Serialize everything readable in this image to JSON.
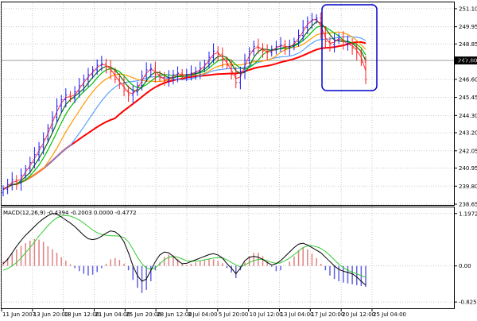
{
  "chart_data": {
    "type": "line",
    "price_panel": {
      "y_ticks": [
        "251.10",
        "249.95",
        "248.85",
        "247.80",
        "246.60",
        "245.45",
        "244.30",
        "243.20",
        "242.05",
        "240.95",
        "239.80",
        "238.65"
      ],
      "y_tick_values": [
        251.1,
        249.95,
        248.85,
        247.8,
        246.6,
        245.45,
        244.3,
        243.2,
        242.05,
        240.95,
        239.8,
        238.65
      ],
      "ylim": [
        238.65,
        251.45
      ],
      "current_price": "247.80",
      "current_price_value": 247.8,
      "grid": true,
      "series_colors": {
        "bars": "#1a1aff",
        "bars_down": "#ff2020",
        "ma1": "#ff3030",
        "ma2": "#007000",
        "ma3": "#00c000",
        "ma4": "#ff9900",
        "ma5": "#5aa0ff",
        "ma6": "#ff0000"
      },
      "close": [
        239.6,
        239.9,
        240.2,
        240.0,
        240.5,
        240.9,
        241.3,
        241.8,
        242.3,
        242.8,
        243.5,
        244.2,
        244.9,
        245.3,
        245.6,
        245.4,
        245.8,
        246.2,
        246.6,
        246.9,
        247.2,
        247.5,
        247.6,
        247.4,
        247.1,
        246.6,
        246.3,
        245.9,
        245.6,
        245.8,
        246.2,
        246.8,
        247.2,
        247.3,
        246.9,
        246.7,
        246.5,
        246.7,
        246.9,
        247.0,
        246.8,
        246.9,
        247.0,
        247.1,
        247.3,
        247.6,
        248.0,
        248.4,
        248.2,
        247.8,
        247.5,
        246.9,
        246.4,
        247.1,
        247.8,
        248.4,
        248.7,
        248.6,
        248.4,
        248.3,
        248.5,
        248.7,
        248.8,
        248.6,
        248.7,
        249.0,
        249.4,
        249.9,
        250.3,
        250.4,
        250.5,
        249.5,
        249.0,
        248.8,
        249.1,
        249.3,
        248.8,
        248.9,
        248.6,
        248.3,
        247.7,
        246.6
      ]
    },
    "macd_panel": {
      "label": "MACD(12,26,9) -0.4394 -0.2003 0.0000 -0.4772",
      "y_ticks": [
        "1.1972",
        "0.00",
        "-0.8255"
      ],
      "y_tick_values": [
        1.1972,
        0.0,
        -0.8255
      ],
      "ylim": [
        -0.95,
        1.32
      ],
      "histogram": [
        0.1,
        0.18,
        0.28,
        0.38,
        0.46,
        0.52,
        0.58,
        0.62,
        0.6,
        0.55,
        0.45,
        0.38,
        0.3,
        0.2,
        0.12,
        0.04,
        -0.05,
        -0.12,
        -0.18,
        -0.22,
        -0.2,
        -0.14,
        -0.05,
        0.05,
        0.15,
        0.18,
        0.14,
        0.05,
        -0.1,
        -0.32,
        -0.5,
        -0.62,
        -0.55,
        -0.35,
        -0.1,
        0.08,
        0.2,
        0.26,
        0.24,
        0.16,
        0.06,
        0.02,
        0.05,
        0.08,
        0.11,
        0.14,
        0.16,
        0.15,
        0.12,
        0.06,
        -0.05,
        -0.15,
        -0.28,
        -0.1,
        0.08,
        0.22,
        0.3,
        0.3,
        0.22,
        0.1,
        -0.02,
        -0.12,
        -0.1,
        0.0,
        0.1,
        0.22,
        0.36,
        0.42,
        0.38,
        0.28,
        0.18,
        0.05,
        -0.1,
        -0.22,
        -0.3,
        -0.35,
        -0.38,
        -0.4,
        -0.42,
        -0.44,
        -0.46,
        -0.48
      ],
      "macd_line": [
        0.05,
        0.15,
        0.3,
        0.45,
        0.58,
        0.7,
        0.8,
        0.9,
        1.0,
        1.08,
        1.15,
        1.2,
        1.18,
        1.12,
        1.05,
        0.98,
        0.9,
        0.8,
        0.7,
        0.62,
        0.6,
        0.62,
        0.68,
        0.75,
        0.8,
        0.78,
        0.7,
        0.55,
        0.3,
        0.0,
        -0.22,
        -0.35,
        -0.3,
        -0.1,
        0.1,
        0.25,
        0.32,
        0.3,
        0.22,
        0.12,
        0.05,
        0.06,
        0.1,
        0.14,
        0.18,
        0.22,
        0.26,
        0.28,
        0.25,
        0.18,
        0.05,
        -0.05,
        -0.18,
        -0.05,
        0.12,
        0.2,
        0.22,
        0.2,
        0.15,
        0.08,
        0.02,
        0.05,
        0.12,
        0.22,
        0.32,
        0.42,
        0.5,
        0.52,
        0.48,
        0.42,
        0.36,
        0.3,
        0.2,
        0.1,
        0.0,
        -0.08,
        -0.12,
        -0.15,
        -0.18,
        -0.25,
        -0.35,
        -0.44
      ],
      "signal_line": [
        -0.1,
        -0.06,
        0.0,
        0.08,
        0.18,
        0.3,
        0.42,
        0.55,
        0.68,
        0.8,
        0.92,
        1.02,
        1.1,
        1.14,
        1.15,
        1.14,
        1.1,
        1.05,
        0.98,
        0.9,
        0.82,
        0.76,
        0.72,
        0.7,
        0.69,
        0.69,
        0.68,
        0.65,
        0.55,
        0.38,
        0.2,
        0.05,
        -0.05,
        -0.08,
        -0.04,
        0.05,
        0.14,
        0.2,
        0.22,
        0.2,
        0.16,
        0.12,
        0.11,
        0.11,
        0.12,
        0.14,
        0.16,
        0.18,
        0.19,
        0.18,
        0.14,
        0.08,
        0.02,
        -0.02,
        0.02,
        0.08,
        0.12,
        0.15,
        0.15,
        0.12,
        0.08,
        0.06,
        0.07,
        0.12,
        0.18,
        0.26,
        0.34,
        0.42,
        0.46,
        0.46,
        0.44,
        0.4,
        0.33,
        0.24,
        0.14,
        0.04,
        -0.04,
        -0.1,
        -0.14,
        -0.18,
        -0.22,
        -0.26
      ],
      "histogram_up_color": "#e08080",
      "histogram_down_color": "#6060e0",
      "macd_color": "#000000",
      "signal_color": "#33cc33"
    },
    "x_ticks": [
      "11 Jun 2007",
      "13 Jun 20:00",
      "18 Jun 12:00",
      "21 Jun 04:00",
      "25 Jun 20:00",
      "28 Jun 12:00",
      "3 Jul 04:00",
      "5 Jul 20:00",
      "10 Jul 12:00",
      "13 Jul 04:00",
      "17 Jul 20:00",
      "20 Jul 12:00",
      "25 Jul 04:00"
    ],
    "highlight_box_color": "#0000cc"
  }
}
